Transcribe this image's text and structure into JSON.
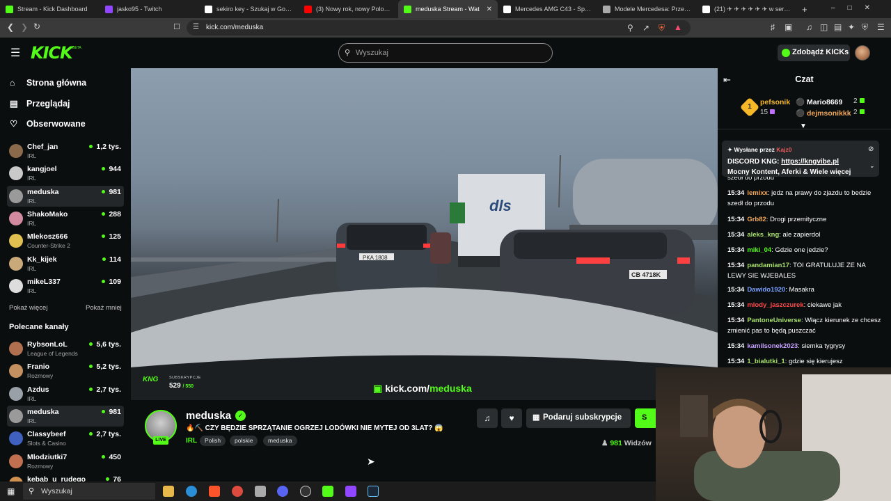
{
  "browser": {
    "tabs": [
      {
        "label": "Stream - Kick Dashboard",
        "color": "#53fc18"
      },
      {
        "label": "jasko95 - Twitch",
        "color": "#9146ff"
      },
      {
        "label": "sekiro key - Szukaj w Google",
        "color": "#ffffff"
      },
      {
        "label": "(3) Nowy rok, nowy Polonez (n",
        "color": "#ff0000"
      },
      {
        "label": "meduska Stream - Wat",
        "color": "#53fc18"
      },
      {
        "label": "Mercedes AMG C43 - Spotkam",
        "color": "#ffffff"
      },
      {
        "label": "Modele Mercedesa: Przegląd n",
        "color": "#aaaaaa"
      },
      {
        "label": "(21) ✈ ✈ ✈ ✈ ✈ ✈ w serwisie",
        "color": "#ffffff"
      }
    ],
    "new_tab": "+",
    "url": "kick.com/meduska"
  },
  "header": {
    "logo": "KICK",
    "logo_badge": "BETA",
    "search_placeholder": "Wyszukaj",
    "kicks_button": "Zdobądź KICKs"
  },
  "sidebar": {
    "nav": [
      {
        "label": "Strona główna",
        "icon": "home-icon"
      },
      {
        "label": "Przeglądaj",
        "icon": "browse-icon"
      },
      {
        "label": "Obserwowane",
        "icon": "heart-icon"
      }
    ],
    "followed": [
      {
        "name": "Chef_jan",
        "category": "IRL",
        "viewers": "1,2 tys.",
        "color": "#8a6a4a"
      },
      {
        "name": "kangjoel",
        "category": "IRL",
        "viewers": "944",
        "color": "#c9c9c9"
      },
      {
        "name": "meduska",
        "category": "IRL",
        "viewers": "981",
        "color": "#9a9a9a"
      },
      {
        "name": "ShakoMako",
        "category": "IRL",
        "viewers": "288",
        "color": "#d28aa0"
      },
      {
        "name": "Mlekosz666",
        "category": "Counter-Strike 2",
        "viewers": "125",
        "color": "#e0c050"
      },
      {
        "name": "Kk_kijek",
        "category": "IRL",
        "viewers": "114",
        "color": "#c9a87a"
      },
      {
        "name": "mikeL337",
        "category": "IRL",
        "viewers": "109",
        "color": "#dddddd"
      }
    ],
    "show_more": "Pokaż więcej",
    "show_less": "Pokaż mniej",
    "recommended_title": "Polecane kanały",
    "recommended": [
      {
        "name": "RybsonLoL",
        "category": "League of Legends",
        "viewers": "5,6 tys.",
        "color": "#b07050"
      },
      {
        "name": "Franio",
        "category": "Rozmowy",
        "viewers": "5,2 tys.",
        "color": "#c49060"
      },
      {
        "name": "Azdus",
        "category": "IRL",
        "viewers": "2,7 tys.",
        "color": "#9aa0a8"
      },
      {
        "name": "meduska",
        "category": "IRL",
        "viewers": "981",
        "color": "#9a9a9a"
      },
      {
        "name": "Classybeef",
        "category": "Slots & Casino",
        "viewers": "2,7 tys.",
        "color": "#4060c0"
      },
      {
        "name": "Mlodziutki7",
        "category": "Rozmowy",
        "viewers": "450",
        "color": "#c07050"
      },
      {
        "name": "kebab_u_rudego",
        "category": "",
        "viewers": "76",
        "color": "#d09050"
      }
    ]
  },
  "video": {
    "subs_label": "SUBSKRYPCJE",
    "subs_count": "529",
    "subs_goal": "/ 550",
    "watermark_prefix": "kick.com/",
    "watermark_user": "meduska",
    "kng_badge": "KNG",
    "plate_left": "PKA 1808",
    "plate_right": "CB 4718K"
  },
  "stream": {
    "streamer": "meduska",
    "live": "LIVE",
    "title": "🔥⛏️ CZY BĘDZIE SPRZĄTANIE OGRZEJ LODÓWKI NIE MYTEJ OD 3LAT? 😱",
    "category": "IRL",
    "tags": [
      "Polish",
      "polskie",
      "meduska"
    ],
    "gift_button": "Podaruj subskrypcje",
    "sub_button": "S",
    "viewers": "981",
    "viewers_label": "Widzów"
  },
  "chat": {
    "title": "Czat",
    "podium": {
      "first": {
        "rank": "1",
        "name": "pefsonik",
        "count": "15"
      },
      "second": {
        "name": "Mario8669",
        "count": "2"
      },
      "third": {
        "name": "dejmsonikkk",
        "count": "2"
      }
    },
    "pinned": {
      "by_label": "Wysłane przez",
      "by_user": "Kajz0",
      "line1_prefix": "DISCORD KNG: ",
      "line1_link": "https://kngvibe.pl",
      "line2": "Mocny Kontent, Aferki & Wiele więcej"
    },
    "partial_message": "szedł do przodu",
    "messages": [
      {
        "time": "15:34",
        "user": "lemixx",
        "color": "#f2a85b",
        "text": "jedz na prawy do zjazdu to bedzie szedł do przodu"
      },
      {
        "time": "15:34",
        "user": "Grb82",
        "color": "#f2a85b",
        "text": "Drogi przemityczne"
      },
      {
        "time": "15:34",
        "user": "aleks_kng",
        "color": "#a8e06a",
        "text": "ale zapierdol"
      },
      {
        "time": "15:34",
        "user": "miki_04",
        "color": "#53fc18",
        "text": "Gdzie one jedzie?"
      },
      {
        "time": "15:34",
        "user": "pandamian17",
        "color": "#a8e06a",
        "text": "TOI GRATULUJE ZE NA LEWY SIE WJEBALES"
      },
      {
        "time": "15:34",
        "user": "Dawido1920",
        "color": "#7aa0ff",
        "text": "Masakra"
      },
      {
        "time": "15:34",
        "user": "mlody_jaszczurek",
        "color": "#ff4a4a",
        "text": "ciekawe jak"
      },
      {
        "time": "15:34",
        "user": "PantoneUniverse",
        "color": "#a8e06a",
        "text": "Włącz kierunek ze chcesz zmienić pas to będą puszczać"
      },
      {
        "time": "15:34",
        "user": "kamilsonek2023",
        "color": "#c8a0ff",
        "text": "siemka tygrysy"
      },
      {
        "time": "15:34",
        "user": "1_bialutki_1",
        "color": "#a8e06a",
        "text": "gdzie się kierujesz"
      }
    ]
  },
  "taskbar": {
    "search_placeholder": "Wyszukaj"
  }
}
